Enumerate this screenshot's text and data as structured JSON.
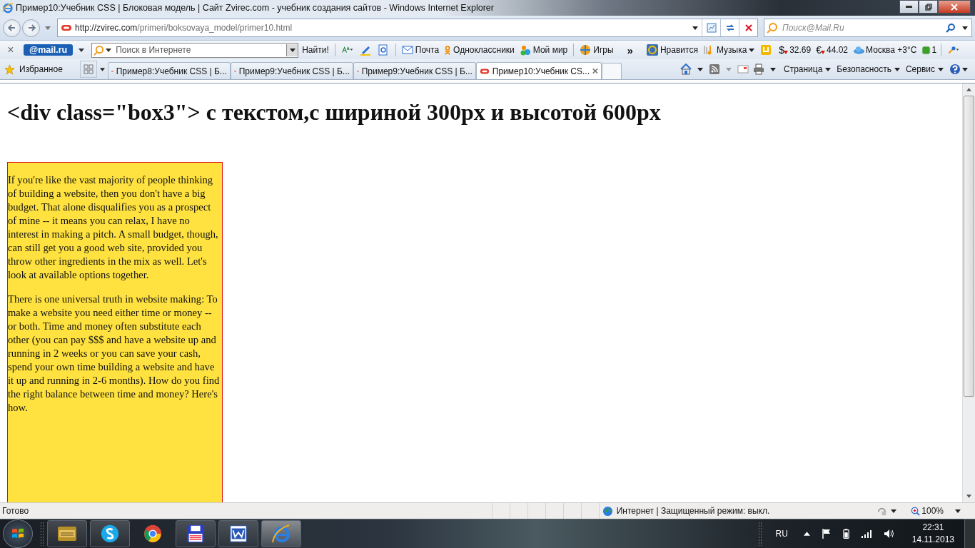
{
  "window": {
    "title": "Пример10:Учебник CSS | Блоковая модель | Сайт Zvirec.com - учебник создания сайтов - Windows Internet Explorer"
  },
  "address_bar": {
    "url_host": "http://zvirec.com",
    "url_path": "/primeri/boksovaya_model/primer10.html"
  },
  "search_box": {
    "placeholder": "Поиск@Mail.Ru"
  },
  "mail_toolbar": {
    "close": "×",
    "logo": "@mail.ru",
    "search_placeholder": "Поиск в Интернете",
    "search_button": "Найти!",
    "links": [
      "Почта",
      "Одноклассники",
      "Мой мир",
      "Игры"
    ],
    "more": "»",
    "links2": [
      "Нравится",
      "Музыка"
    ],
    "rates": [
      {
        "symbol": "$",
        "value": "32.69"
      },
      {
        "symbol": "€",
        "value": "44.02"
      }
    ],
    "weather": "Москва +3°C",
    "counter": "1"
  },
  "favorites": {
    "label": "Избранное"
  },
  "tabs": [
    {
      "label": "Пример8:Учебник CSS | Б...",
      "selected": false
    },
    {
      "label": "Пример9:Учебник CSS | Б...",
      "selected": false
    },
    {
      "label": "Пример9:Учебник CSS | Б...",
      "selected": false
    },
    {
      "label": "Пример10:Учебник CS...",
      "selected": true
    }
  ],
  "commands": [
    "Страница",
    "Безопасность",
    "Сервис"
  ],
  "page": {
    "heading": "<div class=\"box3\"> с текстом,с шириной 300px и высотой 600px",
    "paragraphs": [
      "If you're like the vast majority of people thinking of building a website, then you don't have a big budget. That alone disqualifies you as a prospect of mine -- it means you can relax, I have no interest in making a pitch. A small budget, though, can still get you a good web site, provided you throw other ingredients in the mix as well. Let's look at available options together.",
      "There is one universal truth in website making: To make a website you need either time or money -- or both. Time and money often substitute each other (you can pay $$$ and have a website up and running in 2 weeks or you can save your cash, spend your own time building a website and have it up and running in 2-6 months). How do you find the right balance between time and money? Here's how."
    ]
  },
  "status_bar": {
    "text": "Готово",
    "zone": "Интернет | Защищенный режим: выкл.",
    "zoom": "100%"
  },
  "taskbar": {
    "language": "RU",
    "time": "22:31",
    "date": "14.11.2013"
  }
}
